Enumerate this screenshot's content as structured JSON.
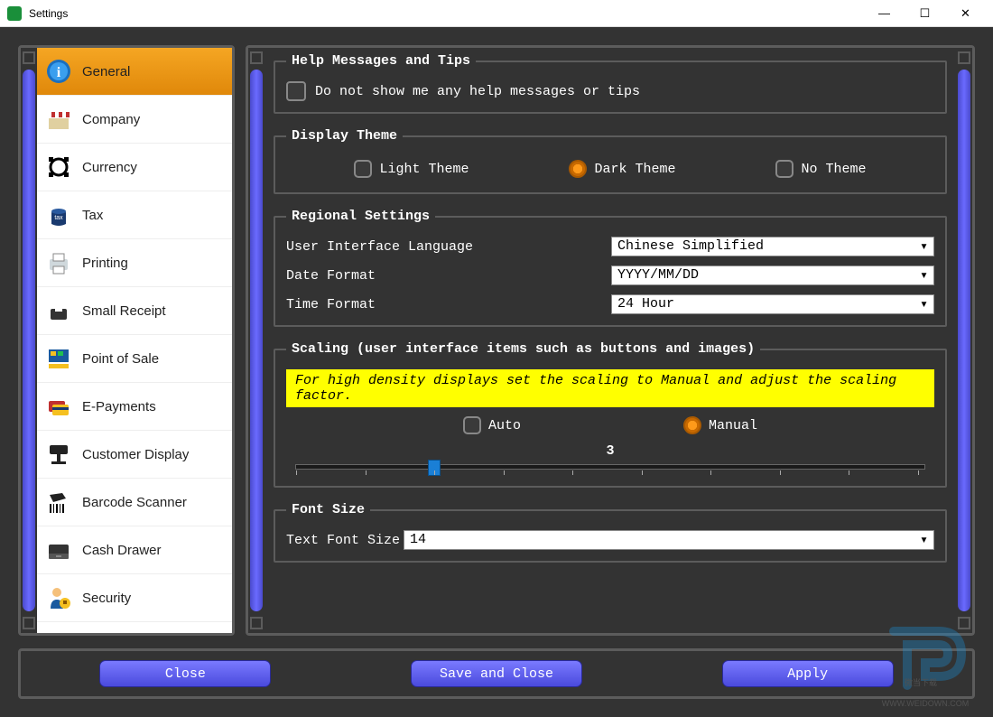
{
  "window": {
    "title": "Settings"
  },
  "sidebar": {
    "items": [
      {
        "label": "General",
        "active": true
      },
      {
        "label": "Company"
      },
      {
        "label": "Currency"
      },
      {
        "label": "Tax"
      },
      {
        "label": "Printing"
      },
      {
        "label": "Small Receipt"
      },
      {
        "label": "Point of Sale"
      },
      {
        "label": "E-Payments"
      },
      {
        "label": "Customer Display"
      },
      {
        "label": "Barcode Scanner"
      },
      {
        "label": "Cash Drawer"
      },
      {
        "label": "Security"
      }
    ]
  },
  "help": {
    "legend": "Help Messages and Tips",
    "checkbox_label": "Do not show me any help messages or tips",
    "checked": false
  },
  "theme": {
    "legend": "Display Theme",
    "options": {
      "light": "Light Theme",
      "dark": "Dark Theme",
      "none": "No Theme"
    },
    "selected": "dark"
  },
  "regional": {
    "legend": "Regional Settings",
    "language_label": "User Interface Language",
    "language_value": "Chinese Simplified",
    "date_label": "Date Format",
    "date_value": "YYYY/MM/DD",
    "time_label": "Time Format",
    "time_value": "24 Hour"
  },
  "scaling": {
    "legend": "Scaling (user interface items such as buttons and images)",
    "hint": "For high density displays set the scaling to Manual and adjust the scaling factor.",
    "auto_label": "Auto",
    "manual_label": "Manual",
    "mode": "manual",
    "value": "3"
  },
  "font": {
    "legend": "Font Size",
    "label": "Text Font Size",
    "value": "14"
  },
  "footer": {
    "close": "Close",
    "save_close": "Save and Close",
    "apply": "Apply"
  },
  "watermark": "WWW.WEIDOWN.COM"
}
